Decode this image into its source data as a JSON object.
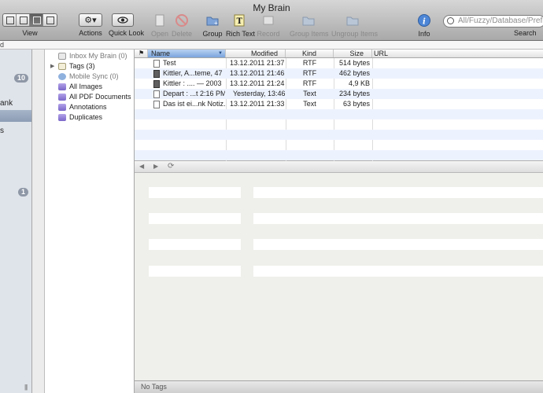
{
  "window": {
    "title": "My Brain"
  },
  "toolbar": {
    "view_label": "View",
    "actions_label": "Actions",
    "quicklook_label": "Quick Look",
    "open_label": "Open",
    "delete_label": "Delete",
    "group_label": "Group",
    "richtext_label": "Rich Text",
    "record_label": "Record",
    "group_items_label": "Group Items",
    "ungroup_items_label": "Ungroup Items",
    "info_label": "Info",
    "search_label": "Search",
    "search_placeholder": "All/Fuzzy/Database/Prefix"
  },
  "pathbar": {
    "text": "d"
  },
  "sidebar": {
    "badge1": "10",
    "item_partial": "ank",
    "item_partial2": "s",
    "badge2": "1"
  },
  "groups": [
    {
      "label": "Inbox My Brain (0)",
      "icon": "inbox-icon",
      "dim": true
    },
    {
      "label": "Tags (3)",
      "icon": "tags-icon",
      "dim": false
    },
    {
      "label": "Mobile Sync (0)",
      "icon": "sync-icon",
      "dim": true
    },
    {
      "label": "All Images",
      "icon": "folder-icon",
      "dim": false
    },
    {
      "label": "All PDF Documents",
      "icon": "folder-icon",
      "dim": false
    },
    {
      "label": "Annotations",
      "icon": "folder-icon",
      "dim": false
    },
    {
      "label": "Duplicates",
      "icon": "folder-icon",
      "dim": false
    }
  ],
  "columns": {
    "name": "Name",
    "modified": "Modified",
    "kind": "Kind",
    "size": "Size",
    "url": "URL"
  },
  "documents": [
    {
      "name": "Test",
      "modified": "13.12.2011 21:37",
      "kind": "RTF",
      "size": "514 bytes",
      "url": "",
      "icon": "rtf-icon"
    },
    {
      "name": "Kittler, A...teme, 47",
      "modified": "13.12.2011 21:46",
      "kind": "RTF",
      "size": "462 bytes",
      "url": "",
      "icon": "image-doc-icon"
    },
    {
      "name": "Kittler : .... — 2003",
      "modified": "13.12.2011 21:24",
      "kind": "RTF",
      "size": "4,9 KB",
      "url": "",
      "icon": "image-doc-icon"
    },
    {
      "name": "Depart : ...t 2:16 PM",
      "modified": "Yesterday, 13:46",
      "kind": "Text",
      "size": "234 bytes",
      "url": "",
      "icon": "text-icon"
    },
    {
      "name": "Das ist ei...nk Notiz.",
      "modified": "13.12.2011 21:33",
      "kind": "Text",
      "size": "63 bytes",
      "url": "",
      "icon": "text-icon"
    }
  ],
  "status": {
    "tags": "No Tags"
  }
}
